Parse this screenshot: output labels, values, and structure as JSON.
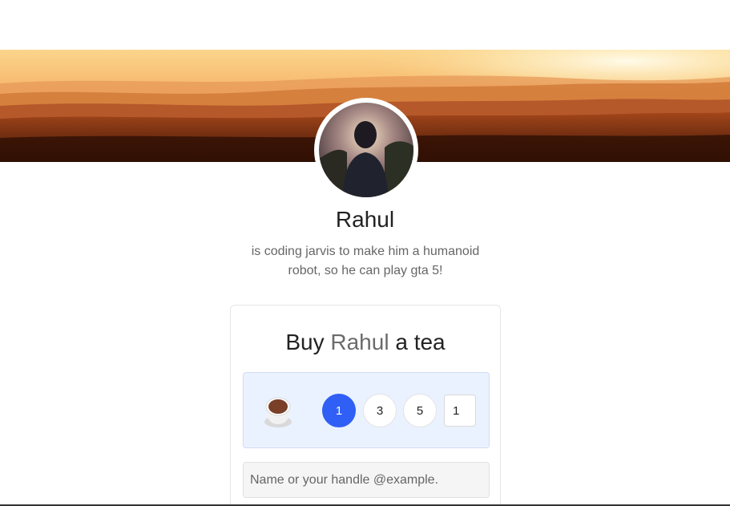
{
  "profile": {
    "name": "Rahul",
    "bio": "is coding jarvis to make him a humanoid robot, so he can play gta 5!"
  },
  "support_card": {
    "title_prefix": "Buy",
    "title_name": "Rahul",
    "title_suffix": "a tea",
    "icon": "tea-cup-icon",
    "quantity_options": [
      "1",
      "3",
      "5"
    ],
    "selected_quantity": "1",
    "custom_quantity": "1",
    "name_placeholder": "Name or your handle @example."
  },
  "colors": {
    "accent": "#2f5ff5",
    "tea_box_bg": "#ebf2ff",
    "cover_sky": "#fbd48a",
    "cover_ground": "#4a1a08"
  }
}
